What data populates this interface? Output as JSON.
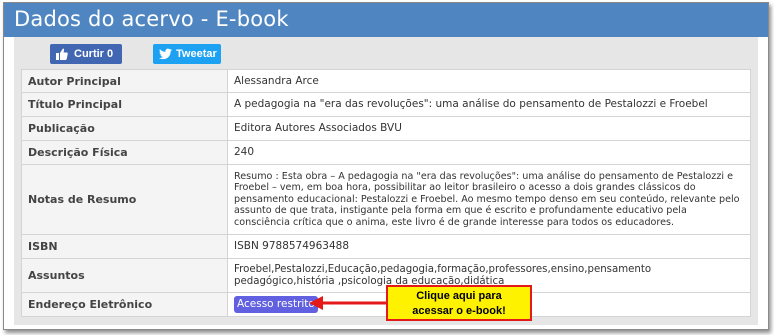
{
  "title": "Dados do acervo - E-book",
  "social": {
    "like_label": "Curtir 0",
    "tweet_label": "Tweetar"
  },
  "fields": [
    {
      "key": "Autor Principal",
      "value": "Alessandra Arce"
    },
    {
      "key": "Título Principal",
      "value": "A pedagogia na \"era das revoluções\": uma análise do pensamento de Pestalozzi e Froebel"
    },
    {
      "key": "Publicação",
      "value": "Editora Autores Associados BVU"
    },
    {
      "key": "Descrição Física",
      "value": "240"
    },
    {
      "key": "Notas de Resumo",
      "value": "Resumo : Esta obra – A pedagogia na \"era das revoluções\": uma análise do pensamento de Pestalozzi e Froebel – vem, em boa hora, possibilitar ao leitor brasileiro o acesso a dois grandes clássicos do pensamento educacional: Pestalozzi e Froebel. Ao mesmo tempo denso em seu conteúdo, relevante pelo assunto de que trata, instigante pela forma em que é escrito e profundamente educativo pela consciência crítica que o anima, este livro é de grande interesse para todos os educadores."
    },
    {
      "key": "ISBN",
      "value": "ISBN 9788574963488"
    },
    {
      "key": "Assuntos",
      "value": " Froebel,Pestalozzi,Educação,pedagogia,formação,professores,ensino,pensamento pedagógico,história ,psicologia da educação,didática"
    },
    {
      "key": "Endereço Eletrônico",
      "value": "Acesso restrito"
    }
  ],
  "callout": {
    "line1": "Clique aqui para",
    "line2": "acessar o e-book!"
  },
  "colors": {
    "header": "#4f86c2",
    "link": "#3b3bd6",
    "access_tag": "#6060e0",
    "callout_bg": "#fff200",
    "callout_border": "#e41a1a"
  }
}
